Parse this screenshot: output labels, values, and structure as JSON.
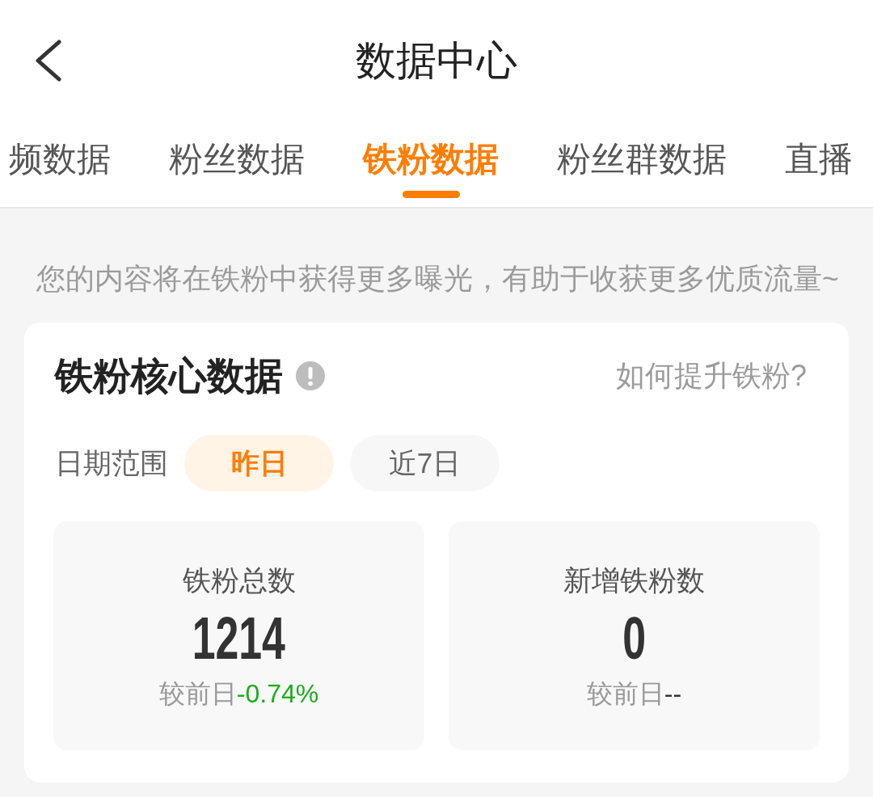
{
  "header": {
    "title": "数据中心"
  },
  "tabs": [
    {
      "label": "频数据",
      "selected": false
    },
    {
      "label": "粉丝数据",
      "selected": false
    },
    {
      "label": "铁粉数据",
      "selected": true
    },
    {
      "label": "粉丝群数据",
      "selected": false
    },
    {
      "label": "直播",
      "selected": false
    }
  ],
  "hint": "您的内容将在铁粉中获得更多曝光，有助于收获更多优质流量~",
  "core_card": {
    "title": "铁粉核心数据",
    "help_link": "如何提升铁粉?",
    "date_range": {
      "label": "日期范围",
      "options": [
        {
          "label": "昨日",
          "selected": true
        },
        {
          "label": "近7日",
          "selected": false
        }
      ]
    },
    "stats": [
      {
        "label": "铁粉总数",
        "value": "1214",
        "compare_label": "较前日",
        "change": "-0.74%",
        "color": "#1aad19"
      },
      {
        "label": "新增铁粉数",
        "value": "0",
        "compare_label": "较前日",
        "change": "--",
        "color": "#333333"
      }
    ]
  }
}
